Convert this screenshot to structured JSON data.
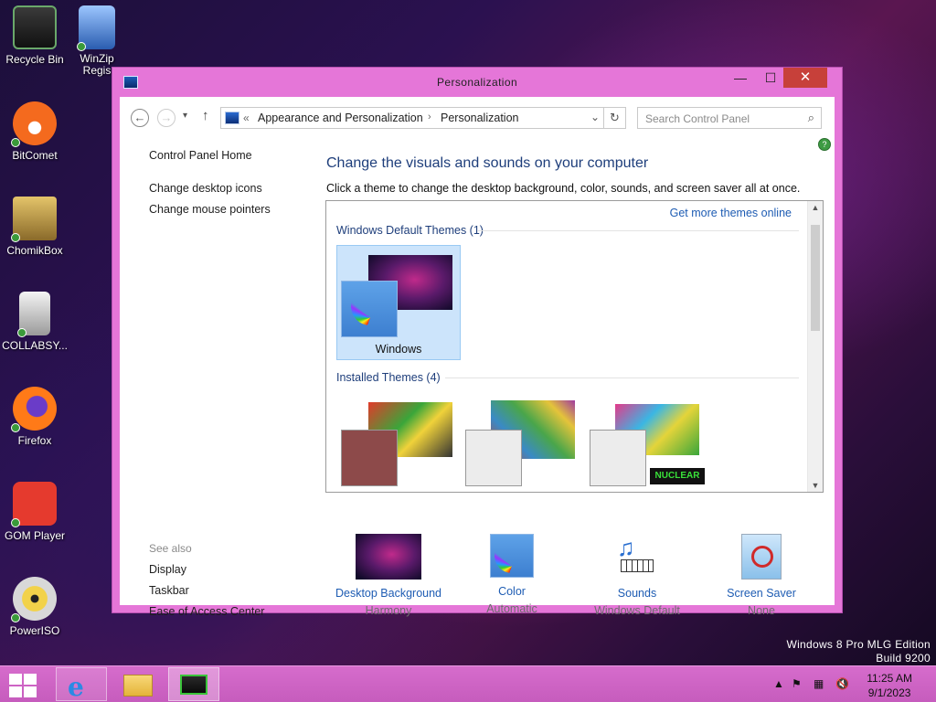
{
  "desktop": {
    "icons": [
      {
        "label": "Recycle Bin"
      },
      {
        "label": "WinZip Regis"
      },
      {
        "label": "BitComet"
      },
      {
        "label": "ChomikBox"
      },
      {
        "label": "COLLABSY..."
      },
      {
        "label": "Firefox"
      },
      {
        "label": "GOM Player"
      },
      {
        "label": "PowerISO"
      }
    ],
    "watermark": {
      "line1": "Windows 8 Pro MLG Edition",
      "line2": "Build 9200"
    }
  },
  "window": {
    "title": "Personalization",
    "controls": {
      "minimize": "—",
      "maximize": "☐",
      "close": "✕"
    },
    "colors": {
      "frame": "#e576d8",
      "close": "#c7403a",
      "link": "#1e5cb3",
      "heading": "#1e3e7b"
    }
  },
  "nav": {
    "address": {
      "prefix": "«",
      "crumbs": [
        "Appearance and Personalization",
        "Personalization"
      ],
      "separator": "›"
    },
    "search_placeholder": "Search Control Panel"
  },
  "sidebar": {
    "home": "Control Panel Home",
    "links": [
      "Change desktop icons",
      "Change mouse pointers"
    ],
    "see_also_title": "See also",
    "see_also": [
      "Display",
      "Taskbar",
      "Ease of Access Center"
    ]
  },
  "main": {
    "title": "Change the visuals and sounds on your computer",
    "description": "Click a theme to change the desktop background, color, sounds, and screen saver all at once.",
    "get_more": "Get more themes online",
    "default_section": "Windows Default Themes (1)",
    "default_theme": "Windows",
    "installed_section": "Installed Themes (4)",
    "installed_badge": "NUCLEAR"
  },
  "bottom": [
    {
      "label": "Desktop Background",
      "value": "Harmony"
    },
    {
      "label": "Color",
      "value": "Automatic"
    },
    {
      "label": "Sounds",
      "value": "Windows Default"
    },
    {
      "label": "Screen Saver",
      "value": "None"
    }
  ],
  "taskbar": {
    "time": "11:25 AM",
    "date": "9/1/2023",
    "tray_icons": [
      "chevron-up-icon",
      "flag-icon",
      "network-icon",
      "volume-muted-icon"
    ]
  }
}
